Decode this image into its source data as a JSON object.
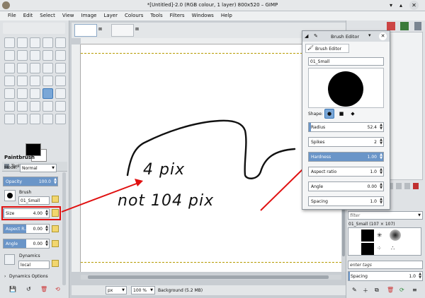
{
  "window": {
    "title": "*[Untitled]-2.0 (RGB colour, 1 layer) 800x520 – GIMP"
  },
  "menubar": {
    "items": [
      "File",
      "Edit",
      "Select",
      "View",
      "Image",
      "Layer",
      "Colours",
      "Tools",
      "Filters",
      "Windows",
      "Help"
    ]
  },
  "tool_options": {
    "tab_label": "Tool Options",
    "tool_name": "Paintbrush",
    "mode_label": "Mode:",
    "mode_value": "Normal",
    "opacity_label": "Opacity",
    "opacity_value": "100.0",
    "brush_label": "Brush",
    "brush_value": "01_Small",
    "size_label": "Size",
    "size_value": "4.00",
    "aspect_label": "Aspect R...",
    "aspect_value": "0.00",
    "angle_label": "Angle",
    "angle_value": "0.00",
    "dynamics_label": "Dynamics",
    "dynamics_value": "local",
    "dynamics_options_label": "Dynamics Options"
  },
  "brush_editor": {
    "title": "Brush Editor",
    "tab_label": "Brush Editor",
    "brush_name": "01_Small",
    "shape_label": "Shape:",
    "radius_label": "Radius",
    "radius_value": "52.4",
    "spikes_label": "Spikes",
    "spikes_value": "2",
    "hardness_label": "Hardness",
    "hardness_value": "1.00",
    "aspect_label": "Aspect ratio",
    "aspect_value": "1.0",
    "angle_label": "Angle",
    "angle_value": "0.00",
    "spacing_label": "Spacing",
    "spacing_value": "1.0"
  },
  "canvas": {
    "annotation_line1": "4 pix",
    "annotation_line2": "not 104 pix"
  },
  "statusbar": {
    "unit": "px",
    "zoom": "100 %",
    "layer_info": "Background (5.2 MB)"
  },
  "right_dock": {
    "filter_placeholder": "filter",
    "brush_info": "01_Small (107 × 107)",
    "tags_placeholder": "enter tags",
    "spacing_label": "Spacing",
    "spacing_value": "1.0"
  },
  "colors": {
    "accent": "#6a95c8",
    "annotation": "#e01010",
    "selection": "#7aa7d7"
  }
}
